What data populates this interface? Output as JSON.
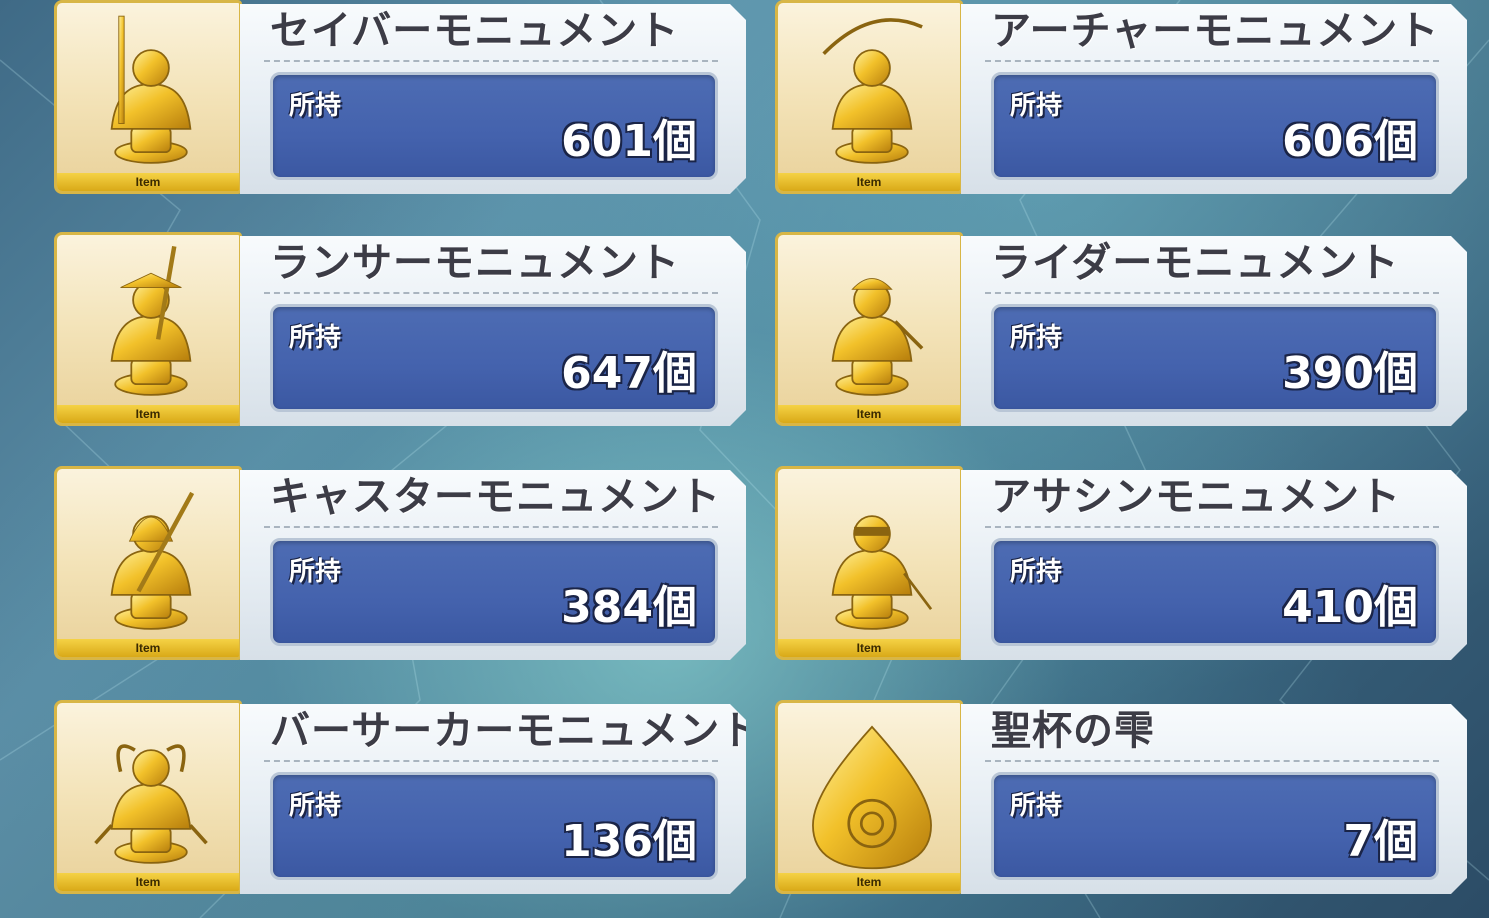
{
  "items": [
    {
      "name": "セイバーモニュメント",
      "owned_label": "所持",
      "count": "601個",
      "tag": "Item",
      "icon": "saber-statue-icon"
    },
    {
      "name": "アーチャーモニュメント",
      "owned_label": "所持",
      "count": "606個",
      "tag": "Item",
      "icon": "archer-statue-icon"
    },
    {
      "name": "ランサーモニュメント",
      "owned_label": "所持",
      "count": "647個",
      "tag": "Item",
      "icon": "lancer-statue-icon"
    },
    {
      "name": "ライダーモニュメント",
      "owned_label": "所持",
      "count": "390個",
      "tag": "Item",
      "icon": "rider-statue-icon"
    },
    {
      "name": "キャスターモニュメント",
      "owned_label": "所持",
      "count": "384個",
      "tag": "Item",
      "icon": "caster-statue-icon"
    },
    {
      "name": "アサシンモニュメント",
      "owned_label": "所持",
      "count": "410個",
      "tag": "Item",
      "icon": "assassin-statue-icon"
    },
    {
      "name": "バーサーカーモニュメント",
      "owned_label": "所持",
      "count": "136個",
      "tag": "Item",
      "icon": "berserker-statue-icon"
    },
    {
      "name": "聖杯の雫",
      "owned_label": "所持",
      "count": "7個",
      "tag": "Item",
      "icon": "grail-drop-icon"
    }
  ],
  "colors": {
    "gold": "#d8b646",
    "owned_box": "#4462ad",
    "panel": "#e6edf3",
    "name_text": "#3c3c46"
  }
}
